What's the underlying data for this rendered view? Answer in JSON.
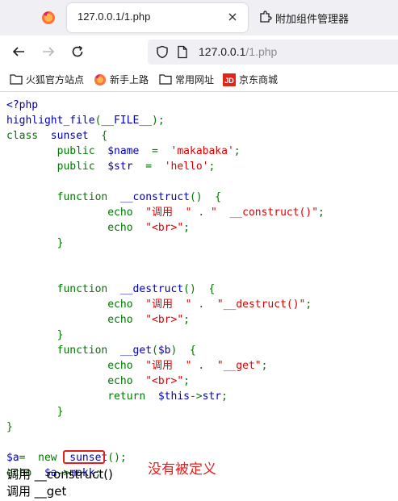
{
  "browser": {
    "tab_title": "127.0.0.1/1.php",
    "extension_tab_title": "附加组件管理器",
    "url_host": "127.0.0.1",
    "url_path": "/1.php",
    "bookmarks": [
      {
        "label": "火狐官方站点",
        "icon": "folder-icon"
      },
      {
        "label": "新手上路",
        "icon": "firefox-icon"
      },
      {
        "label": "常用网址",
        "icon": "folder-icon"
      },
      {
        "label": "京东商城",
        "icon": "jd-icon"
      }
    ]
  },
  "code_lines": [
    [
      [
        "c-default",
        "&lt;?php"
      ]
    ],
    [
      [
        "c-default",
        "highlight_file"
      ],
      [
        "c-keyword",
        "("
      ],
      [
        "c-default",
        "__FILE__"
      ],
      [
        "c-keyword",
        ");"
      ]
    ],
    [
      [
        "c-keyword",
        "class&nbsp;&nbsp;"
      ],
      [
        "c-default",
        "sunset&nbsp;&nbsp;"
      ],
      [
        "c-keyword",
        "{"
      ]
    ],
    [
      [
        "c-keyword",
        "&nbsp;&nbsp;&nbsp;&nbsp;&nbsp;&nbsp;&nbsp;&nbsp;public&nbsp;&nbsp;"
      ],
      [
        "c-default",
        "$name&nbsp;&nbsp;"
      ],
      [
        "c-keyword",
        "=&nbsp;&nbsp;"
      ],
      [
        "c-string",
        "'makabaka'"
      ],
      [
        "c-keyword",
        ";"
      ]
    ],
    [
      [
        "c-keyword",
        "&nbsp;&nbsp;&nbsp;&nbsp;&nbsp;&nbsp;&nbsp;&nbsp;public&nbsp;&nbsp;"
      ],
      [
        "c-default",
        "$str&nbsp;&nbsp;"
      ],
      [
        "c-keyword",
        "=&nbsp;&nbsp;"
      ],
      [
        "c-string",
        "'hello'"
      ],
      [
        "c-keyword",
        ";"
      ]
    ],
    [
      [
        "c-keyword",
        ""
      ]
    ],
    [
      [
        "c-keyword",
        "&nbsp;&nbsp;&nbsp;&nbsp;&nbsp;&nbsp;&nbsp;&nbsp;function&nbsp;&nbsp;"
      ],
      [
        "c-default",
        "__construct"
      ],
      [
        "c-keyword",
        "()&nbsp;&nbsp;{"
      ]
    ],
    [
      [
        "c-keyword",
        "&nbsp;&nbsp;&nbsp;&nbsp;&nbsp;&nbsp;&nbsp;&nbsp;&nbsp;&nbsp;&nbsp;&nbsp;&nbsp;&nbsp;&nbsp;&nbsp;echo&nbsp;&nbsp;"
      ],
      [
        "c-string",
        "\"调用&nbsp;&nbsp;\""
      ],
      [
        "c-keyword",
        "&nbsp;.&nbsp;"
      ],
      [
        "c-string",
        "\"&nbsp;&nbsp;__construct()\""
      ],
      [
        "c-keyword",
        ";"
      ]
    ],
    [
      [
        "c-keyword",
        "&nbsp;&nbsp;&nbsp;&nbsp;&nbsp;&nbsp;&nbsp;&nbsp;&nbsp;&nbsp;&nbsp;&nbsp;&nbsp;&nbsp;&nbsp;&nbsp;echo&nbsp;&nbsp;"
      ],
      [
        "c-string",
        "\"&lt;br&gt;\""
      ],
      [
        "c-keyword",
        ";"
      ]
    ],
    [
      [
        "c-keyword",
        "&nbsp;&nbsp;&nbsp;&nbsp;&nbsp;&nbsp;&nbsp;&nbsp;}"
      ]
    ],
    [
      [
        "c-keyword",
        ""
      ]
    ],
    [
      [
        "c-keyword",
        ""
      ]
    ],
    [
      [
        "c-keyword",
        "&nbsp;&nbsp;&nbsp;&nbsp;&nbsp;&nbsp;&nbsp;&nbsp;function&nbsp;&nbsp;"
      ],
      [
        "c-default",
        "__destruct"
      ],
      [
        "c-keyword",
        "()&nbsp;&nbsp;{"
      ]
    ],
    [
      [
        "c-keyword",
        "&nbsp;&nbsp;&nbsp;&nbsp;&nbsp;&nbsp;&nbsp;&nbsp;&nbsp;&nbsp;&nbsp;&nbsp;&nbsp;&nbsp;&nbsp;&nbsp;echo&nbsp;&nbsp;"
      ],
      [
        "c-string",
        "\"调用&nbsp;&nbsp;\""
      ],
      [
        "c-keyword",
        "&nbsp;.&nbsp;&nbsp;"
      ],
      [
        "c-string",
        "\"__destruct()\""
      ],
      [
        "c-keyword",
        ";"
      ]
    ],
    [
      [
        "c-keyword",
        "&nbsp;&nbsp;&nbsp;&nbsp;&nbsp;&nbsp;&nbsp;&nbsp;&nbsp;&nbsp;&nbsp;&nbsp;&nbsp;&nbsp;&nbsp;&nbsp;echo&nbsp;&nbsp;"
      ],
      [
        "c-string",
        "\"&lt;br&gt;\""
      ],
      [
        "c-keyword",
        ";"
      ]
    ],
    [
      [
        "c-keyword",
        "&nbsp;&nbsp;&nbsp;&nbsp;&nbsp;&nbsp;&nbsp;&nbsp;}"
      ]
    ],
    [
      [
        "c-keyword",
        "&nbsp;&nbsp;&nbsp;&nbsp;&nbsp;&nbsp;&nbsp;&nbsp;function&nbsp;&nbsp;"
      ],
      [
        "c-default",
        "__get"
      ],
      [
        "c-keyword",
        "("
      ],
      [
        "c-default",
        "$b"
      ],
      [
        "c-keyword",
        ")&nbsp;&nbsp;{"
      ]
    ],
    [
      [
        "c-keyword",
        "&nbsp;&nbsp;&nbsp;&nbsp;&nbsp;&nbsp;&nbsp;&nbsp;&nbsp;&nbsp;&nbsp;&nbsp;&nbsp;&nbsp;&nbsp;&nbsp;echo&nbsp;&nbsp;"
      ],
      [
        "c-string",
        "\"调用&nbsp;&nbsp;\""
      ],
      [
        "c-keyword",
        "&nbsp;.&nbsp;&nbsp;"
      ],
      [
        "c-string",
        "\"__get\""
      ],
      [
        "c-keyword",
        ";"
      ]
    ],
    [
      [
        "c-keyword",
        "&nbsp;&nbsp;&nbsp;&nbsp;&nbsp;&nbsp;&nbsp;&nbsp;&nbsp;&nbsp;&nbsp;&nbsp;&nbsp;&nbsp;&nbsp;&nbsp;echo&nbsp;&nbsp;"
      ],
      [
        "c-string",
        "\"&lt;br&gt;\""
      ],
      [
        "c-keyword",
        ";"
      ]
    ],
    [
      [
        "c-keyword",
        "&nbsp;&nbsp;&nbsp;&nbsp;&nbsp;&nbsp;&nbsp;&nbsp;&nbsp;&nbsp;&nbsp;&nbsp;&nbsp;&nbsp;&nbsp;&nbsp;return&nbsp;&nbsp;"
      ],
      [
        "c-default",
        "$this"
      ],
      [
        "c-keyword",
        "-&gt;"
      ],
      [
        "c-default",
        "str"
      ],
      [
        "c-keyword",
        ";"
      ]
    ],
    [
      [
        "c-keyword",
        "&nbsp;&nbsp;&nbsp;&nbsp;&nbsp;&nbsp;&nbsp;&nbsp;}"
      ]
    ],
    [
      [
        "c-keyword",
        "}"
      ]
    ],
    [
      [
        "c-keyword",
        ""
      ]
    ],
    [
      [
        "c-default",
        "$a"
      ],
      [
        "c-keyword",
        "=&nbsp;&nbsp;new&nbsp;&nbsp;"
      ],
      [
        "c-default",
        "sunset"
      ],
      [
        "c-keyword",
        "();"
      ]
    ],
    [
      [
        "c-keyword",
        "echo&nbsp;&nbsp;"
      ],
      [
        "c-default",
        "$a"
      ],
      [
        "c-keyword",
        "-&gt;"
      ],
      [
        "c-default",
        "makk"
      ],
      [
        "c-keyword",
        ";"
      ]
    ]
  ],
  "output_lines": [
    "调用 __construct()",
    "调用 __get"
  ],
  "annotation": "没有被定义",
  "colors": {
    "highlight_box": "#e02020"
  }
}
